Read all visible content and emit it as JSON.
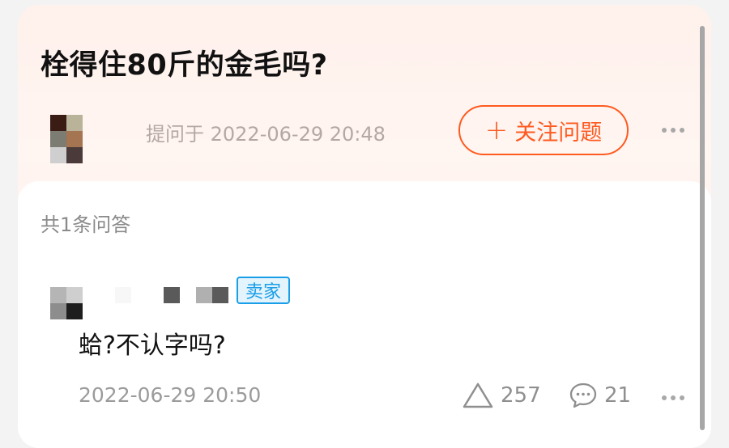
{
  "question": {
    "title": "栓得住80斤的金毛吗?",
    "asked_time": "提问于 2022-06-29 20:48",
    "follow_button": {
      "icon": "plus-icon",
      "label": "关注问题"
    },
    "more_icon": "more-dots-icon"
  },
  "answers": {
    "count_label": "共1条问答",
    "items": [
      {
        "badge": "卖家",
        "text": "蛤?不认字吗?",
        "time": "2022-06-29 20:50",
        "likes": "257",
        "comments": "21",
        "like_icon": "triangle-up-icon",
        "comment_icon": "comment-bubble-icon",
        "more_icon": "more-dots-icon"
      }
    ]
  },
  "colors": {
    "accent": "#ff5a1f",
    "badge": "#1a9ee8",
    "header_bg": "#fff1ec"
  }
}
